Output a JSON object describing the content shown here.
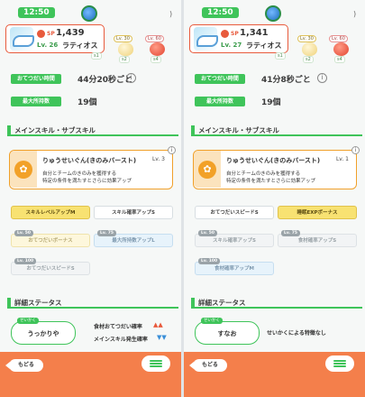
{
  "panes": [
    {
      "clock": "12:50",
      "pokemon": {
        "sp_label": "SP",
        "sp": "1,439",
        "lv": "Lv. 26",
        "name": "ラティオス"
      },
      "slots": [
        {
          "badge": "s1"
        },
        {
          "lv": "Lv. 30",
          "item": "egg",
          "badge": "s2"
        },
        {
          "lv": "Lv. 60",
          "item": "tomato",
          "badge": "s4"
        }
      ],
      "helper_time_label": "おてつだい時間",
      "helper_time": "44分20秒ごと",
      "max_carry_label": "最大所持数",
      "max_carry": "19個",
      "skill_section": "メインスキル・サブスキル",
      "main_skill": {
        "name": "りゅうせいぐん(きのみバースト)",
        "lv": "Lv. 3",
        "desc1": "自分とチームのきのみを獲得する",
        "desc2": "特定の条件を満たすとさらに効果アップ"
      },
      "sub_skills": [
        {
          "label": "スキルレベルアップM",
          "style": "gold"
        },
        {
          "label": "スキル確率アップS",
          "style": "white"
        },
        {
          "label": "おてつだいボーナス",
          "style": "lock-gold",
          "lock": "Lv. 50"
        },
        {
          "label": "最大所持数アップL",
          "style": "lock-blue",
          "lock": "Lv. 75"
        },
        {
          "label": "おてつだいスピードS",
          "style": "lock-grey",
          "lock": "Lv. 100"
        }
      ],
      "status_section": "詳細ステータス",
      "nature_tag": "せいかく",
      "nature": "うっかりや",
      "effects": [
        "食材おてつだい確率",
        "メインスキル発生確率"
      ],
      "arrows": [
        "▲▲",
        "▼▼"
      ],
      "back": "もどる"
    },
    {
      "clock": "12:50",
      "pokemon": {
        "sp_label": "SP",
        "sp": "1,341",
        "lv": "Lv. 27",
        "name": "ラティオス"
      },
      "slots": [
        {
          "badge": "s1"
        },
        {
          "lv": "Lv. 30",
          "item": "egg",
          "badge": "s2"
        },
        {
          "lv": "Lv. 60",
          "item": "tomato",
          "badge": "s4"
        }
      ],
      "helper_time_label": "おてつだい時間",
      "helper_time": "41分8秒ごと",
      "max_carry_label": "最大所持数",
      "max_carry": "19個",
      "skill_section": "メインスキル・サブスキル",
      "main_skill": {
        "name": "りゅうせいぐん(きのみバースト)",
        "lv": "Lv. 1",
        "desc1": "自分とチームのきのみを獲得する",
        "desc2": "特定の条件を満たすとさらに効果アップ"
      },
      "sub_skills": [
        {
          "label": "おてつだいスピードS",
          "style": "white"
        },
        {
          "label": "睡眠EXPボーナス",
          "style": "gold"
        },
        {
          "label": "スキル確率アップS",
          "style": "lock-grey",
          "lock": "Lv. 50"
        },
        {
          "label": "食材確率アップS",
          "style": "lock-grey",
          "lock": "Lv. 75"
        },
        {
          "label": "食材確率アップM",
          "style": "lock-blue",
          "lock": "Lv. 100"
        }
      ],
      "status_section": "詳細ステータス",
      "nature_tag": "せいかく",
      "nature": "すなお",
      "effects": [
        "せいかくによる特徴なし"
      ],
      "back": "もどる"
    }
  ],
  "colors": {
    "accent": "#3fc45a",
    "footer": "#f47f4b",
    "skill_border": "#f0a02a"
  }
}
